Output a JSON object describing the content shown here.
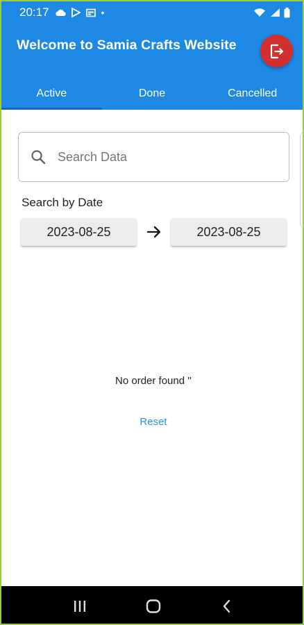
{
  "status_bar": {
    "time": "20:17",
    "dot": "•",
    "left_icons": [
      "cloud-icon",
      "play-store-icon",
      "calendar-icon"
    ],
    "right_icons": [
      "wifi-icon",
      "signal-icon",
      "battery-icon"
    ]
  },
  "header": {
    "title": "Welcome to Samia Crafts Website",
    "logout_icon": "logout-icon"
  },
  "tabs": [
    {
      "label": "Active",
      "active": true
    },
    {
      "label": "Done",
      "active": false
    },
    {
      "label": "Cancelled",
      "active": false
    }
  ],
  "search": {
    "placeholder": "Search Data",
    "value": ""
  },
  "date_filter": {
    "label": "Search by Date",
    "from": "2023-08-25",
    "to": "2023-08-25"
  },
  "empty_state": {
    "message": "No order found ''",
    "reset_label": "Reset"
  },
  "nav_bar": {
    "icons": [
      "recent-apps-icon",
      "home-icon",
      "back-icon"
    ]
  },
  "colors": {
    "primary": "#1e88e5",
    "logout": "#d32f2f",
    "link": "#2196f3"
  }
}
